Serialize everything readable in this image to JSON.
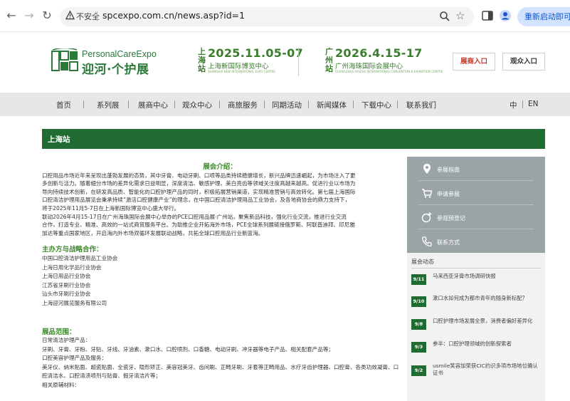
{
  "browser": {
    "insecure_label": "不安全",
    "url": "spcexpo.com.cn/news.asp?id=1",
    "relaunch_label": "重新启动即可更新"
  },
  "logo": {
    "en": "PersonalCareExpo",
    "cn": "迎河·个护展"
  },
  "events": [
    {
      "city": "上海站",
      "date": "2025.11.05-07",
      "venue": "上海新国际博览中心",
      "venue_en": "SHANGHAI NEW INTERNATIONAL EXPO CENTRE"
    },
    {
      "city": "广州站",
      "date": "2026.4.15-17",
      "venue": "广州海珠国际会展中心",
      "venue_en": "GUANGZHOU HAIZHU INTERNATIONAL CONVENTION & EXHIBITION CENTRE"
    }
  ],
  "header_buttons": {
    "exhibitor": "展商入口",
    "visitor": "观众入口"
  },
  "nav": {
    "items": [
      "首页",
      "系列展",
      "展商中心",
      "观众中心",
      "商旅服务",
      "同期活动",
      "新闻媒体",
      "下载中心",
      "联系我们"
    ],
    "lang_cn": "中",
    "lang_en": "EN"
  },
  "banner_title": "上海站",
  "content": {
    "intro_title": "展会介绍：",
    "intro_lines": [
      "口腔用品市场近年来呈现出蓬勃发展的态势，其中牙膏、电动牙刷、口喷等品类持续稳健增长，新兴品牌迅速崛起，为市场注入了更",
      "多创新与活力。随着细分市场的差异化需求日益明显，深度清洁、敏感护理、美白亮齿等领域关注度高越来越高。促进行业以市场为",
      "导向持续技术创新，在研发高品质、智能化的口腔护理产品的同时，积极拓展营销渠道，实现精准营销与高效转化。第七届上海国际",
      "口腔清洁护理用品展览会秉承持续“激活口腔健康产业”的理念，在中国口腔清洁护理用品工业协会，及各地商协会的鼎力支持下，",
      "将于2025年11月5-7日在上海新国际博览中心盛大举行。",
      "联动2026年4月15-17日在广州海珠国际会展中心举办的PCE口腔用品展·广州站，聚焦新品科技，强化行业交流，推进行业交流",
      "合作，打造专业、精准、高效的一站式商贸服务平台。为助推企业开拓海外市场，PCE全球系列展链接俄罗斯、阿联酋迪拜、印尼雅",
      "加达等重点国家地区，开启海内外市场双循环发展联动战略，共拓全球口腔用品行业新蓝海。"
    ],
    "partners_title": "主办方与战略合作：",
    "partners": [
      "中国口腔清洁护理用品工业协会",
      "上海日用化学品行业协会",
      "上海日用品行业协会",
      "江苏省牙刷行业协会",
      "汕头市牙刷行业协会",
      "上海迎河展览服务有限公司"
    ],
    "scope_title": "展品范围：",
    "scope_lines": [
      "日常清洁护理产品：",
      "牙刷、牙膏、牙粉、牙贴、牙线、牙油素、漱口水、口腔喷剂、口香糖、电动牙刷、冲牙器等电子产品、相关配套产品等；",
      "口腔美容护理产品及服务：",
      "美牙仪、纳米贴面、超瓷贴面、全瓷牙、隐形矫正、美容冠美牙、齿间刷、正畸牙刷、牙套等正畸用品、水疗牙齿护理器、口腔膏、各类功效凝膏、口",
      "腔清洁水、口腔清渍喷剂与贴膏、假牙清洁片等；",
      "相关原辅材料："
    ]
  },
  "sidebar": {
    "links": [
      "参展指南",
      "申请参展",
      "参观预登记",
      "联系方式"
    ],
    "news_heading": "展会动态",
    "news": [
      {
        "date": "9/11",
        "title": "马来西亚牙膏市场调研快报"
      },
      {
        "date": "9/10",
        "title": "漱口水如何成为都市青年的随身新标配？"
      },
      {
        "date": "9/8",
        "title": "口腔护理市场发展全景，消费者偏好差异化"
      },
      {
        "date": "9/3",
        "title": "参半：口腔护理领域的创新探索者"
      },
      {
        "date": "9/2",
        "title": "usmile笑容加荣获CIC约识多项市场地位确认证书"
      }
    ]
  },
  "colors": {
    "brand_green": "#1f6b32",
    "accent_green": "#3d8b2c",
    "exhibitor_red": "#c0392b"
  }
}
